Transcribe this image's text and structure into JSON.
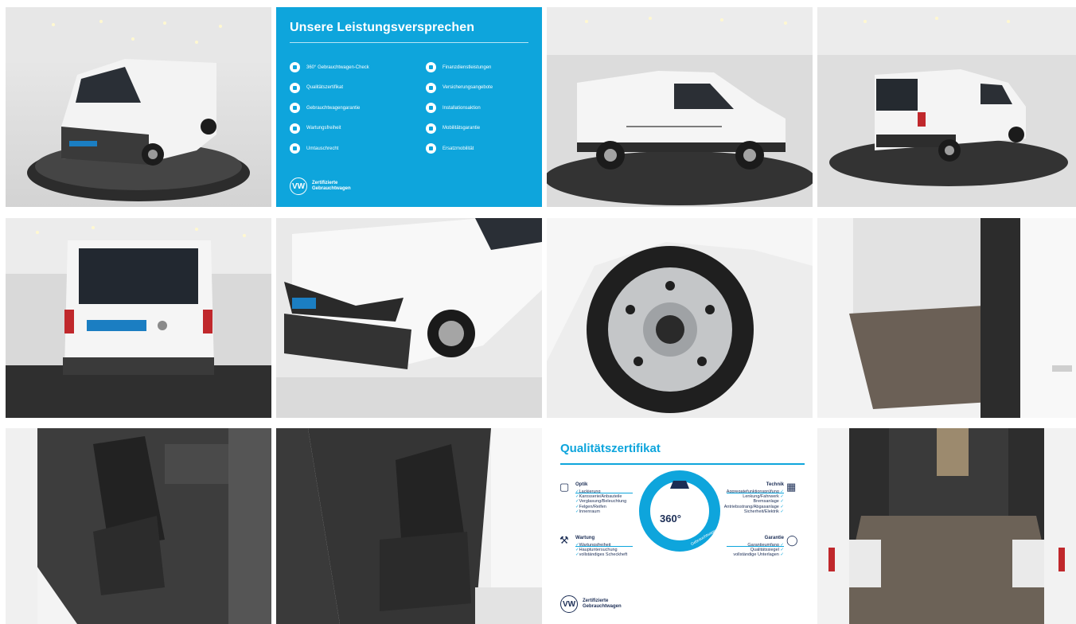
{
  "gallery": {
    "images": [
      {
        "name": "van-front-left-photo",
        "alt": "VW Caddy Kastenwagen Frontansicht"
      },
      {
        "name": "leistungsversprechen-card"
      },
      {
        "name": "van-side-photo"
      },
      {
        "name": "van-rear-right-photo"
      },
      {
        "name": "van-rear-photo"
      },
      {
        "name": "van-front-corner-photo"
      },
      {
        "name": "wheel-photo"
      },
      {
        "name": "cargo-side-door-photo"
      },
      {
        "name": "driver-seat-photo"
      },
      {
        "name": "passenger-seat-photo"
      },
      {
        "name": "qualitaetszertifikat-card"
      },
      {
        "name": "cargo-rear-photo"
      }
    ]
  },
  "promise_card": {
    "title": "Unsere Leistungsversprechen",
    "left_items": [
      "360° Gebrauchtwagen-Check",
      "Qualitätszertifikat",
      "Gebrauchtwagengarantie",
      "Wartungsfreiheit",
      "Umtauschrecht"
    ],
    "right_items": [
      "Finanzdienstleistungen",
      "Versicherungsangebote",
      "Installationsaktion",
      "Mobilitätsgarantie",
      "Ersatzmobilität"
    ],
    "brand_line1": "Zertifizierte",
    "brand_line2": "Gebrauchtwagen",
    "logo_letters": "VW",
    "accent": "#0ea5dc"
  },
  "quality_card": {
    "title": "Qualitätszertifikat",
    "gauge_label": "360°",
    "gauge_arc_text": "Gebrauchtwagen-Check",
    "optik": {
      "heading": "Optik",
      "items": [
        "Lackierung",
        "Karosserie/Anbauteile",
        "Verglasung/Beleuchtung",
        "Felgen/Reifen",
        "Innenraum"
      ]
    },
    "wartung": {
      "heading": "Wartung",
      "items": [
        "Wartungsfreiheit",
        "Hauptuntersuchung",
        "vollständiges Scheckheft"
      ]
    },
    "technik": {
      "heading": "Technik",
      "items": [
        "Aggregatefunktionsprüfung",
        "Lenkung/Fahrwerk",
        "Bremsanlage",
        "Antriebsstrang/Abgasanlage",
        "Sicherheit/Elektrik"
      ]
    },
    "garantie": {
      "heading": "Garantie",
      "items": [
        "Garantieumfang",
        "Qualitätssiegel",
        "vollständige Unterlagen"
      ]
    },
    "brand_line1": "Zertifizierte",
    "brand_line2": "Gebrauchtwagen",
    "logo_letters": "VW"
  }
}
